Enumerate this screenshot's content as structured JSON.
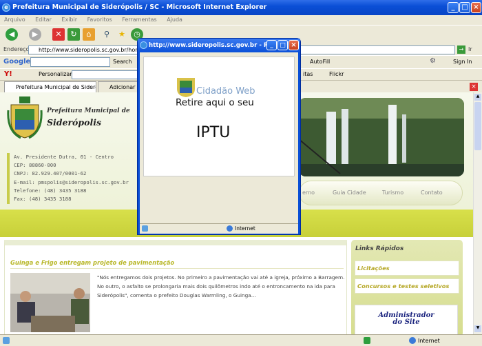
{
  "window": {
    "title": "Prefeitura Municipal de Siderópolis / SC - Microsoft Internet Explorer"
  },
  "menu": [
    "Arquivo",
    "Editar",
    "Exibir",
    "Favoritos",
    "Ferramentas",
    "Ajuda"
  ],
  "address": {
    "label": "Endereço",
    "url": "http://www.sideropolis.sc.gov.br/home/ind",
    "go": "Ir"
  },
  "google": {
    "brand": "Google",
    "search_label": "Search",
    "autofill": "AutoFill",
    "signin": "Sign In"
  },
  "yahoo": {
    "brand": "Y!",
    "personalize": "Personalizar",
    "favorites_frag": "itas",
    "flickr": "Flickr"
  },
  "tabs": [
    {
      "label": "Prefeitura Municipal de Siderópo..."
    },
    {
      "label": "Adicionar a"
    }
  ],
  "site": {
    "org_line1": "Prefeitura Municipal de",
    "org_line2": "Siderópolis",
    "contact": [
      "Av. Presidente Dutra, 01 - Centro",
      "CEP: 88860-000",
      "CNPJ: 82.929.407/0001-62",
      "E-mail: pmspolis@sideropolis.sc.gov.br",
      "Telefone: (48) 3435 3188",
      "Fax: (48) 3435 3188"
    ],
    "nav": [
      "erno",
      "Guia Cidade",
      "Turismo",
      "Contato"
    ],
    "news_title": "Guinga e Frigo entregam projeto de pavimentação",
    "news_text": "\"Nós entregamos dois projetos. No primeiro a pavimentação vai até a igreja, próximo a Barragem. No outro, o asfalto se prolongaria mais dois quilômetros indo até o entroncamento na ida para Siderópolis\", comenta o prefeito Douglas Warmling, o Guinga...",
    "quick_links_title": "Links Rápidos",
    "quick_links": [
      "Licitações",
      "Concursos e testes seletivos"
    ],
    "admin_line1": "Administrador",
    "admin_line2": "do Site"
  },
  "popup": {
    "title": "http://www.sideropolis.sc.gov.br - P...",
    "brand": "Cidadão Web",
    "line1": "Retire aqui o seu",
    "line2": "IPTU",
    "status_zone": "Internet"
  },
  "status": {
    "zone": "Internet"
  }
}
